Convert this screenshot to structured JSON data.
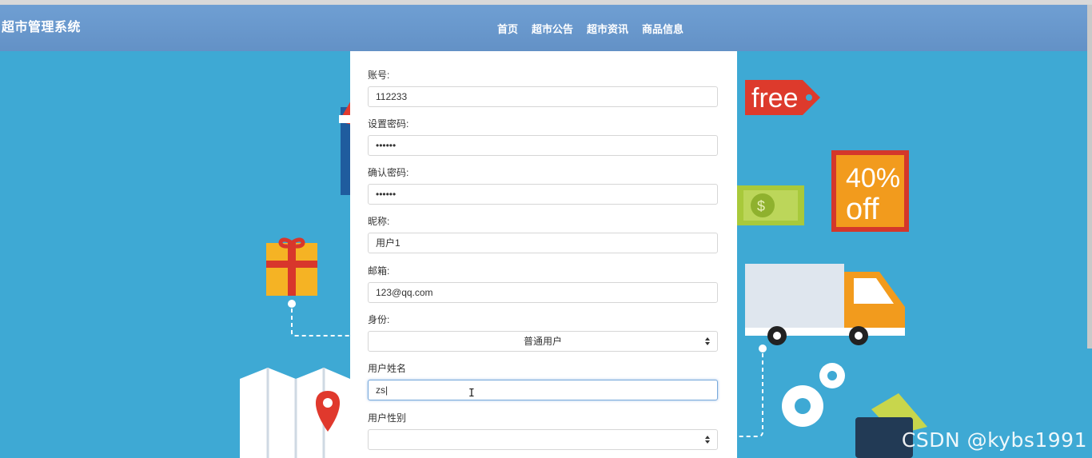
{
  "app": {
    "title": "超市管理系统"
  },
  "nav": {
    "items": [
      "首页",
      "超市公告",
      "超市资讯",
      "商品信息"
    ]
  },
  "form": {
    "account_label": "账号:",
    "account_value": "112233",
    "password_label": "设置密码:",
    "password_value": "••••••",
    "confirm_label": "确认密码:",
    "confirm_value": "••••••",
    "nickname_label": "昵称:",
    "nickname_value": "用户1",
    "email_label": "邮箱:",
    "email_value": "123@qq.com",
    "role_label": "身份:",
    "role_value": "普通用户",
    "realname_label": "用户姓名",
    "realname_value": "zs",
    "gender_label": "用户性别",
    "gender_value": ""
  },
  "background": {
    "tag_text": "free",
    "discount_text_1": "40%",
    "discount_text_2": "off",
    "money_symbol": "$"
  },
  "watermark": "CSDN @kybs1991"
}
